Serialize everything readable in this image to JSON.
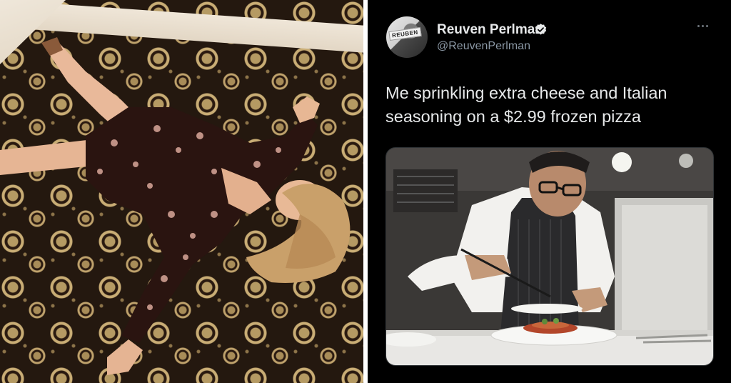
{
  "tweet": {
    "display_name": "Reuven Perlman",
    "handle": "@ReuvenPerlman",
    "text": "Me sprinkling extra cheese and Italian seasoning on a $2.99 frozen pizza",
    "verified": true,
    "avatar_sign_text": "REUBEN"
  },
  "colors": {
    "tweet_background": "#000000",
    "primary_text": "#e7e9ea",
    "secondary_text": "#8b98a5",
    "verified_badge": "#e7e9ea",
    "carpet_base": "#24180f",
    "carpet_pattern": "#c9ad75"
  },
  "icons": {
    "verified": "verified-badge-icon",
    "more": "more-options-icon"
  }
}
